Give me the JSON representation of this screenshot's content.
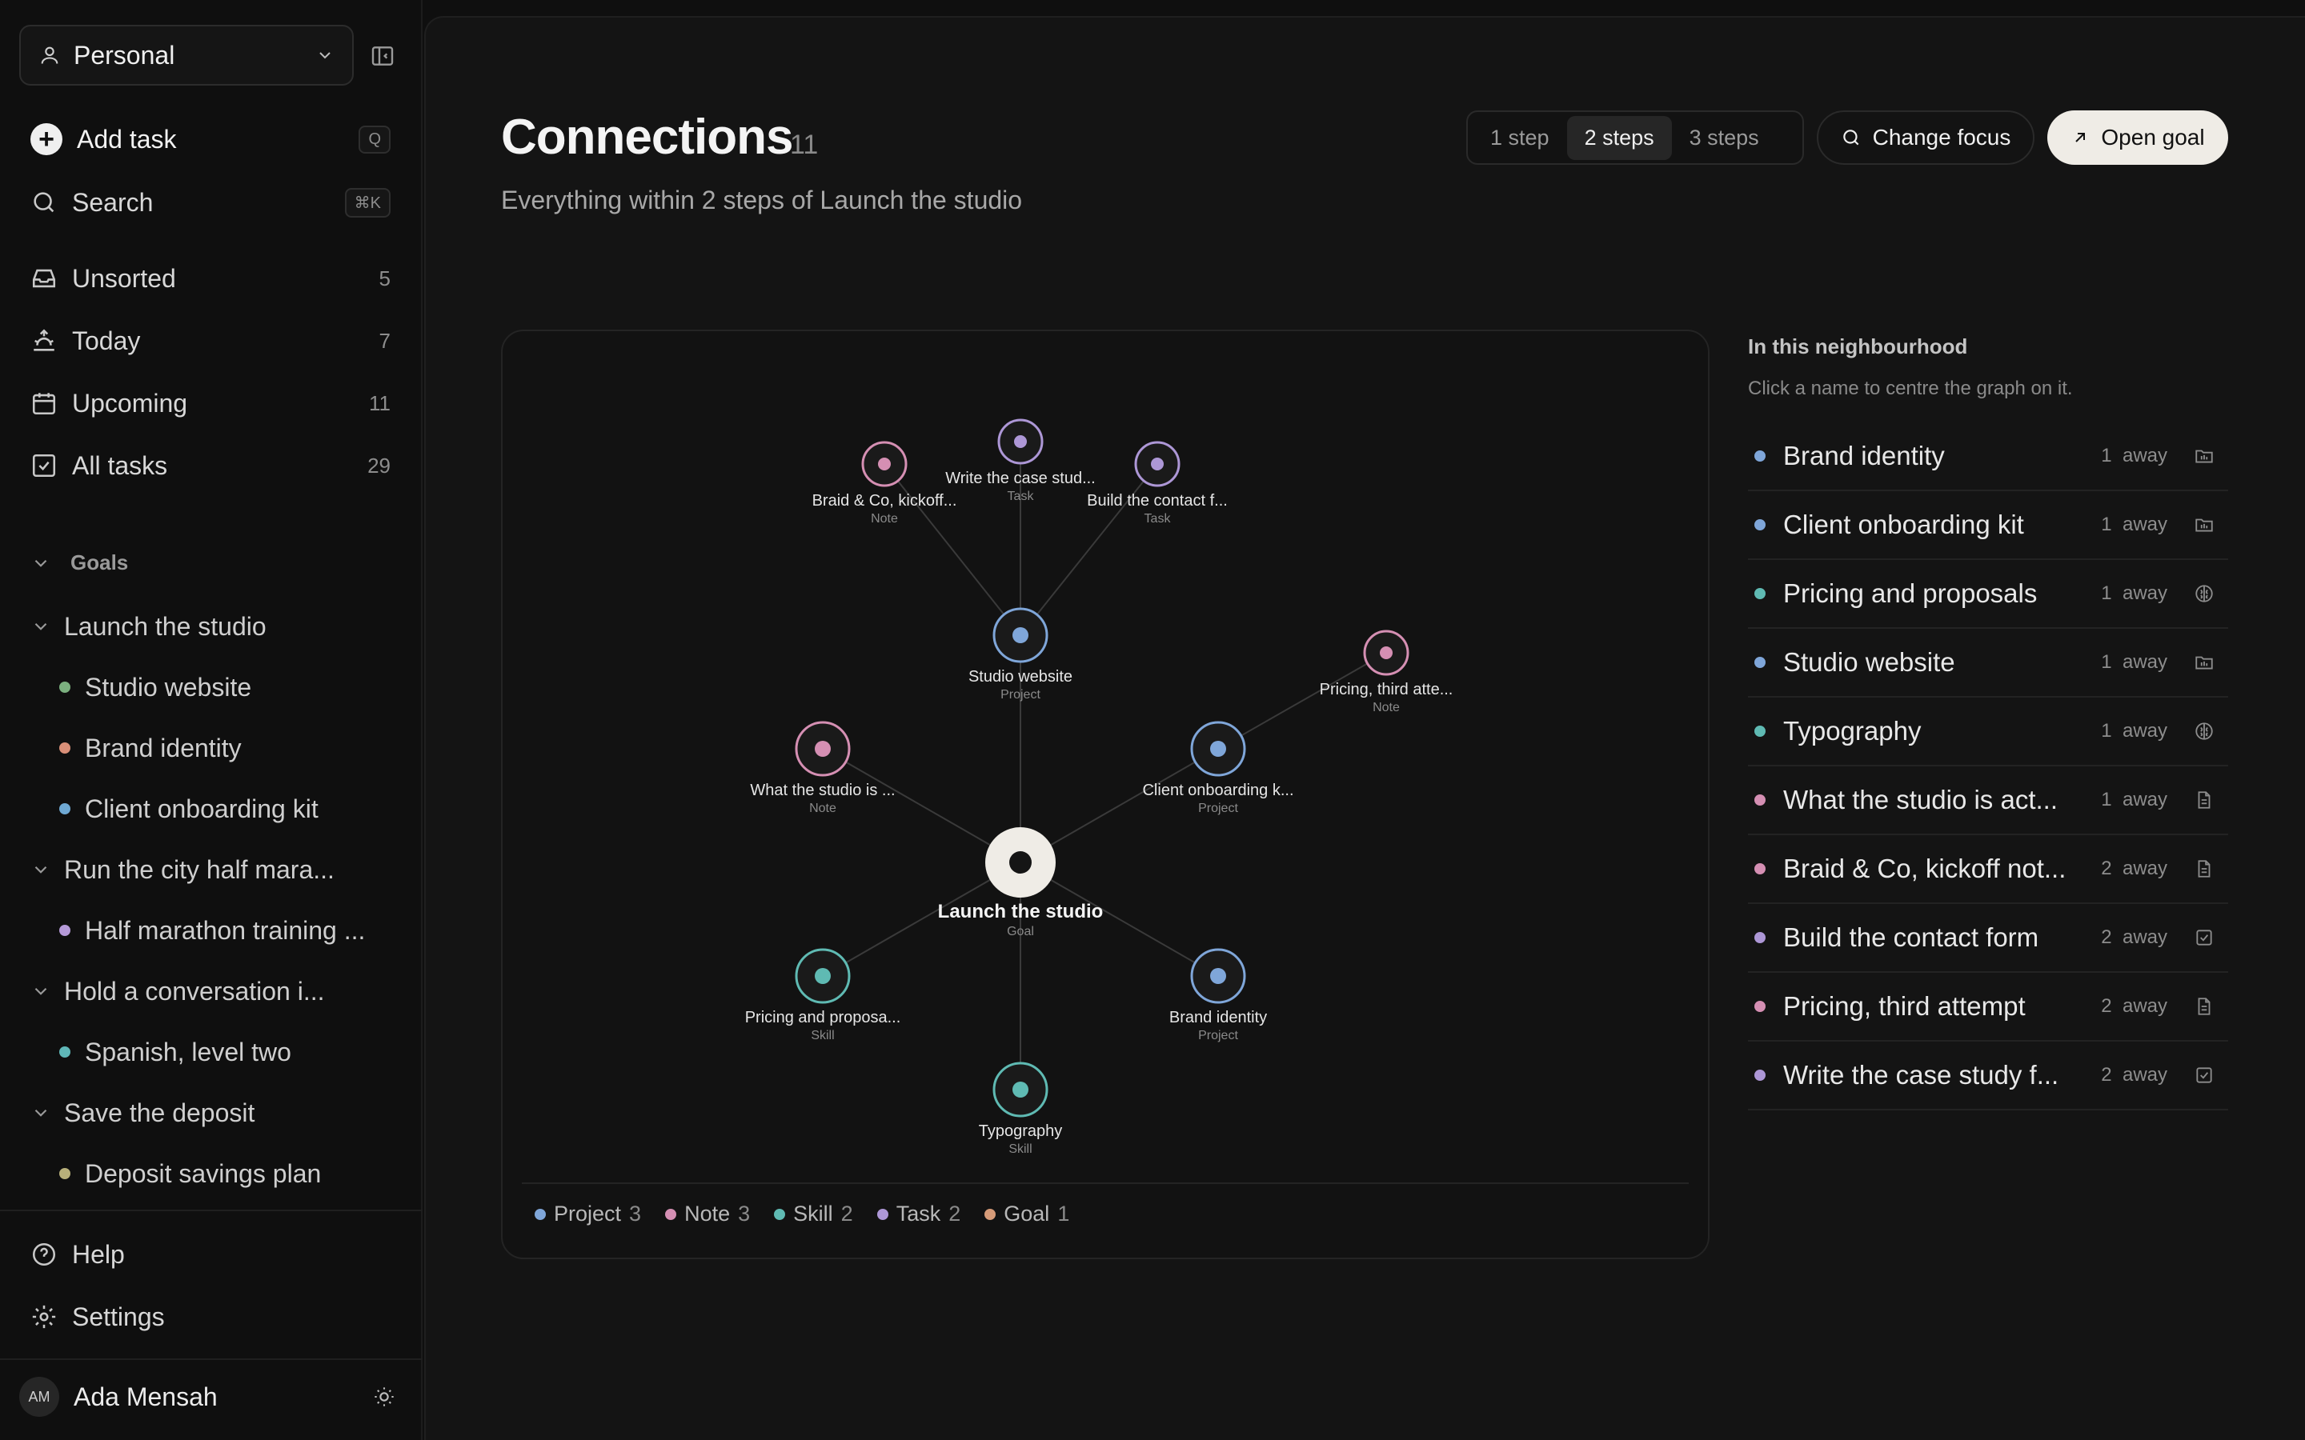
{
  "sidebar": {
    "workspace": "Personal",
    "add_task": "Add task",
    "add_task_shortcut": "Q",
    "search": "Search",
    "search_shortcut": "⌘K",
    "nav": [
      {
        "label": "Unsorted",
        "count": "5",
        "icon": "inbox-icon"
      },
      {
        "label": "Today",
        "count": "7",
        "icon": "sunrise-icon"
      },
      {
        "label": "Upcoming",
        "count": "11",
        "icon": "calendar-icon"
      },
      {
        "label": "All tasks",
        "count": "29",
        "icon": "checkbox-icon"
      }
    ],
    "goals_heading": "Goals",
    "goals": [
      {
        "label": "Launch the studio",
        "children": [
          {
            "label": "Studio website",
            "color": "#7bb07f"
          },
          {
            "label": "Brand identity",
            "color": "#d98f78"
          },
          {
            "label": "Client onboarding kit",
            "color": "#6fa9d4"
          }
        ]
      },
      {
        "label": "Run the city half mara...",
        "children": [
          {
            "label": "Half marathon training ...",
            "color": "#b59ad8"
          }
        ]
      },
      {
        "label": "Hold a conversation i...",
        "children": [
          {
            "label": "Spanish, level two",
            "color": "#5fb7b8"
          }
        ]
      },
      {
        "label": "Save the deposit",
        "children": [
          {
            "label": "Deposit savings plan",
            "color": "#b8b07a"
          }
        ]
      }
    ],
    "help": "Help",
    "settings": "Settings",
    "user_initials": "AM",
    "user_name": "Ada Mensah"
  },
  "header": {
    "title": "Connections",
    "count": "11",
    "subtitle": "Everything within 2 steps of Launch the studio",
    "steps": [
      "1 step",
      "2 steps",
      "3 steps"
    ],
    "active_step": "2 steps",
    "change_focus": "Change focus",
    "open_goal": "Open goal"
  },
  "colors": {
    "project": "#7fa6d9",
    "note": "#d58fb3",
    "skill": "#5fbab3",
    "task": "#ad97d6",
    "goal": "#d69b78"
  },
  "graph": {
    "center": {
      "name": "Launch the studio",
      "type": "Goal"
    },
    "nodes": [
      {
        "id": "studio",
        "name": "Studio website",
        "type": "Project",
        "kind": "project"
      },
      {
        "id": "what",
        "name": "What the studio is ...",
        "type": "Note",
        "kind": "note"
      },
      {
        "id": "client",
        "name": "Client onboarding k...",
        "type": "Project",
        "kind": "project"
      },
      {
        "id": "pricingskill",
        "name": "Pricing and proposa...",
        "type": "Skill",
        "kind": "skill"
      },
      {
        "id": "brand",
        "name": "Brand identity",
        "type": "Project",
        "kind": "project"
      },
      {
        "id": "typo",
        "name": "Typography",
        "type": "Skill",
        "kind": "skill"
      },
      {
        "id": "braid",
        "name": "Braid & Co, kickoff...",
        "type": "Note",
        "kind": "note"
      },
      {
        "id": "casestudy",
        "name": "Write the case stud...",
        "type": "Task",
        "kind": "task"
      },
      {
        "id": "contact",
        "name": "Build the contact f...",
        "type": "Task",
        "kind": "task"
      },
      {
        "id": "pricingnote",
        "name": "Pricing, third atte...",
        "type": "Note",
        "kind": "note"
      }
    ],
    "edges": [
      [
        "center",
        "studio"
      ],
      [
        "center",
        "what"
      ],
      [
        "center",
        "client"
      ],
      [
        "center",
        "pricingskill"
      ],
      [
        "center",
        "brand"
      ],
      [
        "center",
        "typo"
      ],
      [
        "studio",
        "braid"
      ],
      [
        "studio",
        "casestudy"
      ],
      [
        "studio",
        "contact"
      ],
      [
        "client",
        "pricingnote"
      ]
    ]
  },
  "legend": [
    {
      "label": "Project",
      "count": "3",
      "kind": "project"
    },
    {
      "label": "Note",
      "count": "3",
      "kind": "note"
    },
    {
      "label": "Skill",
      "count": "2",
      "kind": "skill"
    },
    {
      "label": "Task",
      "count": "2",
      "kind": "task"
    },
    {
      "label": "Goal",
      "count": "1",
      "kind": "goal"
    }
  ],
  "neighbourhood": {
    "title": "In this neighbourhood",
    "hint": "Click a name to centre the graph on it.",
    "items": [
      {
        "name": "Brand identity",
        "distance": "1  away",
        "kind": "project",
        "icon": "folder-icon"
      },
      {
        "name": "Client onboarding kit",
        "distance": "1  away",
        "kind": "project",
        "icon": "folder-icon"
      },
      {
        "name": "Pricing and proposals",
        "distance": "1  away",
        "kind": "skill",
        "icon": "brain-icon"
      },
      {
        "name": "Studio website",
        "distance": "1  away",
        "kind": "project",
        "icon": "folder-icon"
      },
      {
        "name": "Typography",
        "distance": "1  away",
        "kind": "skill",
        "icon": "brain-icon"
      },
      {
        "name": "What the studio is act...",
        "distance": "1  away",
        "kind": "note",
        "icon": "document-icon"
      },
      {
        "name": "Braid & Co, kickoff not...",
        "distance": "2  away",
        "kind": "note",
        "icon": "document-icon"
      },
      {
        "name": "Build the contact form",
        "distance": "2  away",
        "kind": "task",
        "icon": "checkbox-icon"
      },
      {
        "name": "Pricing, third attempt",
        "distance": "2  away",
        "kind": "note",
        "icon": "document-icon"
      },
      {
        "name": "Write the case study f...",
        "distance": "2  away",
        "kind": "task",
        "icon": "checkbox-icon"
      }
    ]
  }
}
